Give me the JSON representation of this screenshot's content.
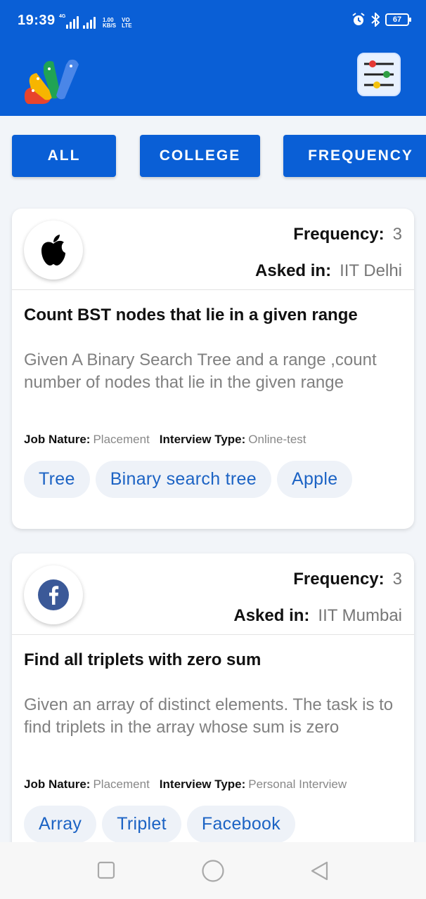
{
  "status": {
    "time": "19:39",
    "network_type": "4G",
    "data_speed_value": "1.00",
    "data_speed_unit": "KB/S",
    "volte_top": "VO",
    "volte_bottom": "LTE",
    "battery": "67"
  },
  "tabs": [
    {
      "label": "ALL"
    },
    {
      "label": "COLLEGE"
    },
    {
      "label": "FREQUENCY"
    }
  ],
  "cards": [
    {
      "company_icon": "apple-icon",
      "frequency_label": "Frequency:",
      "frequency_value": "3",
      "asked_label": "Asked in:",
      "asked_value": "IIT Delhi",
      "title": "Count BST nodes that lie in a given range",
      "description": "Given A Binary Search Tree and a range ,count number of nodes that lie in the given range",
      "job_nature_label": "Job Nature:",
      "job_nature_value": "Placement",
      "interview_type_label": "Interview Type:",
      "interview_type_value": "Online-test",
      "tags": [
        "Tree",
        "Binary search tree",
        "Apple"
      ]
    },
    {
      "company_icon": "facebook-icon",
      "frequency_label": "Frequency:",
      "frequency_value": "3",
      "asked_label": "Asked in:",
      "asked_value": "IIT Mumbai",
      "title": "Find all triplets with zero sum",
      "description": "Given an array of distinct elements. The task is to find triplets in the array whose sum is zero",
      "job_nature_label": "Job Nature:",
      "job_nature_value": "Placement",
      "interview_type_label": "Interview Type:",
      "interview_type_value": "Personal Interview",
      "tags": [
        "Array",
        "Triplet",
        "Facebook"
      ]
    }
  ],
  "colors": {
    "primary": "#0a5fd6",
    "chip_text": "#1c63c4",
    "chip_bg": "#eef2f8",
    "facebook": "#3b5998"
  },
  "icons": [
    "app-logo-icon",
    "filter-sliders-icon",
    "alarm-icon",
    "bluetooth-icon",
    "nav-recents-icon",
    "nav-home-icon",
    "nav-back-icon"
  ]
}
